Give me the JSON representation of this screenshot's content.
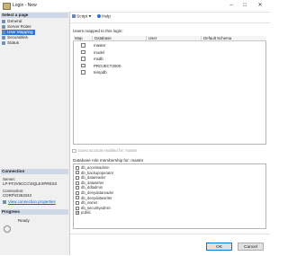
{
  "window": {
    "title": "Login - New"
  },
  "left_pane": {
    "select_page_header": "Select a page",
    "pages": [
      {
        "label": "General",
        "selected": false
      },
      {
        "label": "Server Roles",
        "selected": false
      },
      {
        "label": "User Mapping",
        "selected": true
      },
      {
        "label": "Securables",
        "selected": false
      },
      {
        "label": "Status",
        "selected": false
      }
    ],
    "connection_header": "Connection",
    "server_label": "Server:",
    "server_value": "LP-FF2V9CCC\\SQLEXPRESS",
    "connection_label": "Connection:",
    "connection_value": "CORP\\O363343",
    "view_connection_link": "View connection properties",
    "progress_header": "Progress",
    "progress_status": "Ready"
  },
  "toolbar": {
    "script_label": "Script",
    "help_label": "Help"
  },
  "users_mapped": {
    "label": "Users mapped to this login:",
    "columns": [
      "Map",
      "Database",
      "User",
      "Default Schema"
    ],
    "rows": [
      {
        "map": false,
        "database": "master",
        "user": "",
        "schema": ""
      },
      {
        "map": false,
        "database": "model",
        "user": "",
        "schema": ""
      },
      {
        "map": false,
        "database": "msdb",
        "user": "",
        "schema": ""
      },
      {
        "map": false,
        "database": "PROJECT2000",
        "user": "",
        "schema": ""
      },
      {
        "map": false,
        "database": "tempdb",
        "user": "",
        "schema": ""
      }
    ]
  },
  "guest_account": {
    "label": "Guest account enabled for: master",
    "enabled": false
  },
  "roles": {
    "label": "Database role membership for: master",
    "items": [
      {
        "label": "db_accessadmin",
        "checked": false
      },
      {
        "label": "db_backupoperator",
        "checked": false
      },
      {
        "label": "db_datareader",
        "checked": false
      },
      {
        "label": "db_datawriter",
        "checked": false
      },
      {
        "label": "db_ddladmin",
        "checked": false
      },
      {
        "label": "db_denydatareader",
        "checked": false
      },
      {
        "label": "db_denydatawriter",
        "checked": false
      },
      {
        "label": "db_owner",
        "checked": false
      },
      {
        "label": "db_securityadmin",
        "checked": false
      },
      {
        "label": "public",
        "checked": true
      }
    ]
  },
  "buttons": {
    "ok": "OK",
    "cancel": "Cancel"
  }
}
